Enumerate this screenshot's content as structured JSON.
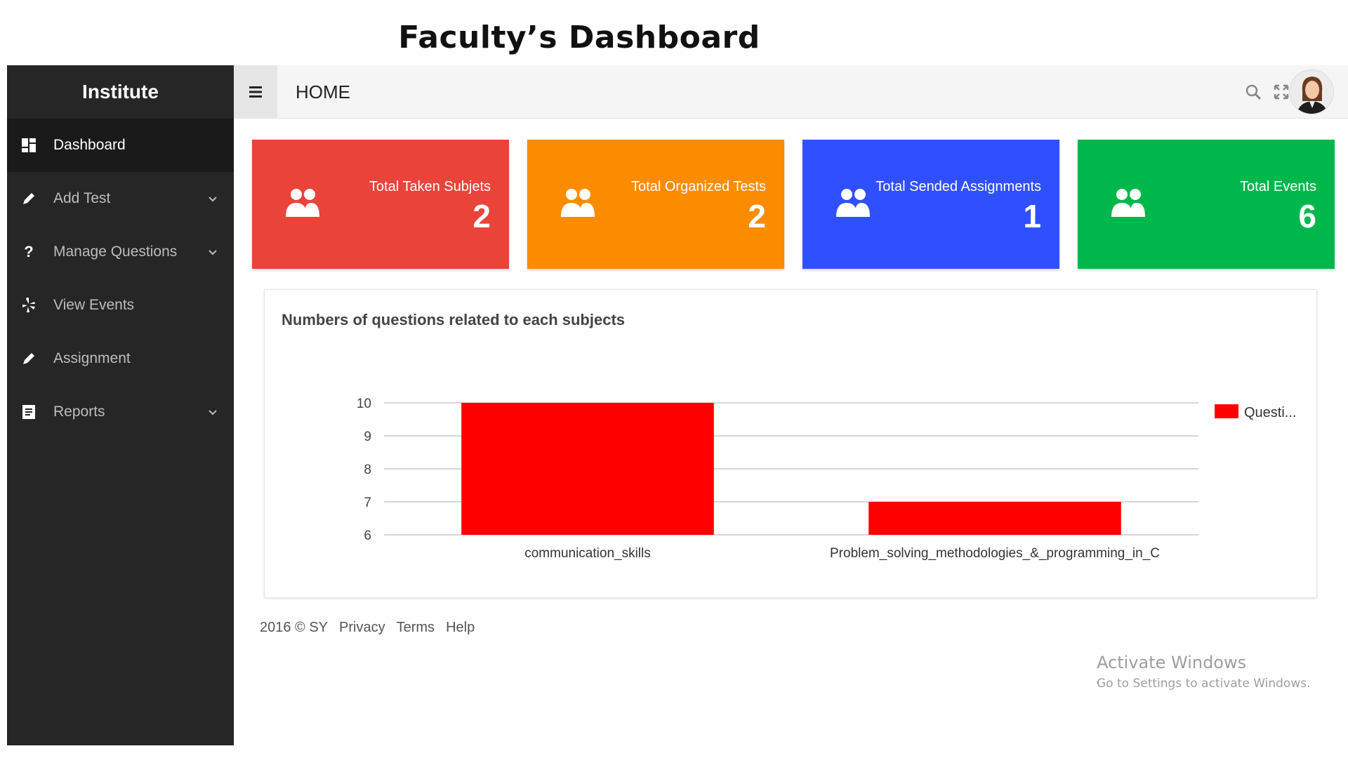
{
  "page_heading": "Faculty’s Dashboard",
  "sidebar": {
    "brand": "Institute",
    "items": [
      {
        "label": "Dashboard",
        "icon": "dashboard-icon",
        "active": true,
        "dropdown": false
      },
      {
        "label": "Add Test",
        "icon": "pencil-icon",
        "active": false,
        "dropdown": true
      },
      {
        "label": "Manage Questions",
        "icon": "question-icon",
        "active": false,
        "dropdown": true
      },
      {
        "label": "View Events",
        "icon": "yelp-icon",
        "active": false,
        "dropdown": false
      },
      {
        "label": "Assignment",
        "icon": "pencil-icon",
        "active": false,
        "dropdown": false
      },
      {
        "label": "Reports",
        "icon": "report-icon",
        "active": false,
        "dropdown": true
      }
    ]
  },
  "topbar": {
    "title": "HOME",
    "icons": [
      "hamburger-icon",
      "search-icon",
      "fullscreen-icon"
    ]
  },
  "cards": [
    {
      "label": "Total Taken Subjets",
      "value": "2",
      "color": "#e9433a",
      "icon": "users-icon"
    },
    {
      "label": "Total Organized Tests",
      "value": "2",
      "color": "#fb8c00",
      "icon": "users-icon"
    },
    {
      "label": "Total Sended Assignments",
      "value": "1",
      "color": "#3050ff",
      "icon": "users-icon"
    },
    {
      "label": "Total Events",
      "value": "6",
      "color": "#00b74c",
      "icon": "users-icon"
    }
  ],
  "chart_data": {
    "type": "bar",
    "title": "Numbers of questions related to each subjects",
    "categories": [
      "communication_skills",
      "Problem_solving_methodologies_&_programming_in_C"
    ],
    "series": [
      {
        "name": "Questi...",
        "values": [
          10,
          7
        ],
        "color": "#ff0000"
      }
    ],
    "ylim": [
      6,
      10
    ],
    "yticks": [
      "10",
      "9",
      "8",
      "7",
      "6"
    ],
    "grid": true,
    "legend": "right"
  },
  "footer": {
    "copyright": "2016 © SY",
    "links": [
      "Privacy",
      "Terms",
      "Help"
    ]
  },
  "watermark": {
    "title": "Activate Windows",
    "subtitle": "Go to Settings to activate Windows."
  }
}
